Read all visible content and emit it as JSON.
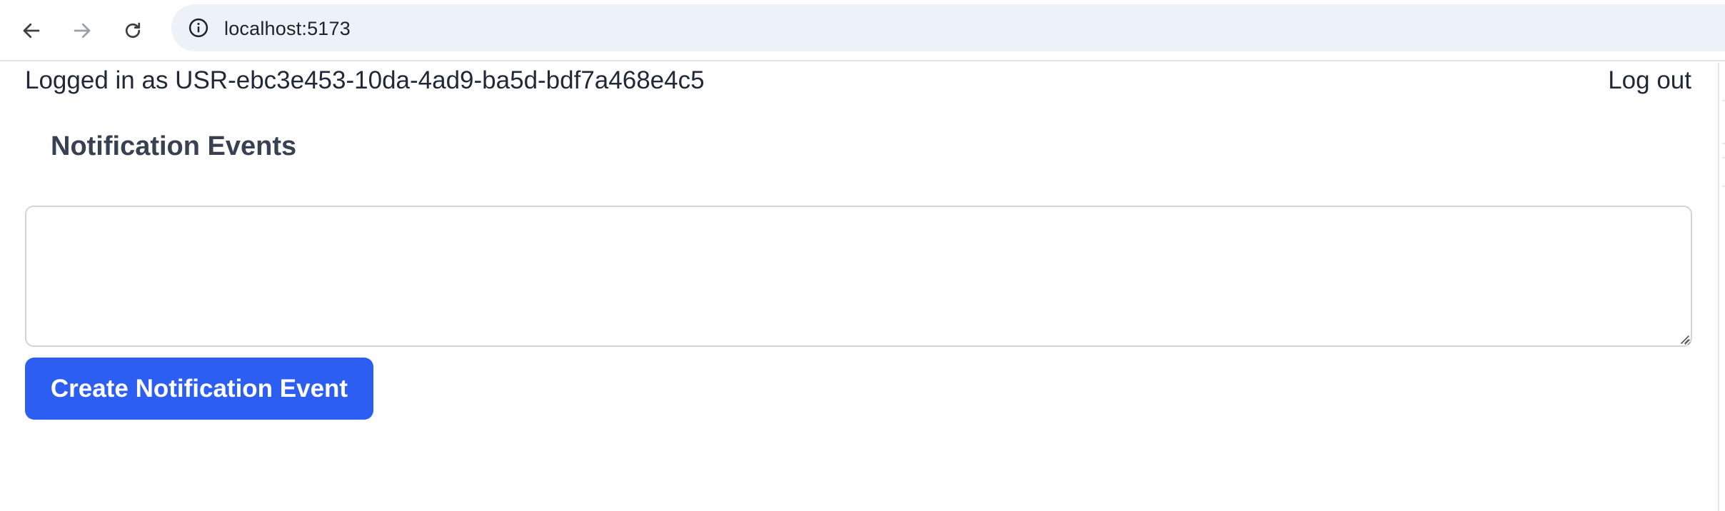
{
  "browser": {
    "url": "localhost:5173",
    "icons": {
      "back": "arrow-left-icon",
      "forward": "arrow-right-icon",
      "reload": "reload-icon",
      "site_info": "info-icon"
    }
  },
  "header": {
    "user_label": "Logged in as USR-ebc3e453-10da-4ad9-ba5d-bdf7a468e4c5",
    "logout_label": "Log out"
  },
  "main": {
    "title": "Notification Events",
    "textarea_value": "",
    "textarea_placeholder": "",
    "create_button_label": "Create Notification Event"
  },
  "colors": {
    "primary_button": "#2d5ef2",
    "address_bar": "#edf1f8",
    "text": "#1f2937",
    "title_text": "#374151"
  }
}
